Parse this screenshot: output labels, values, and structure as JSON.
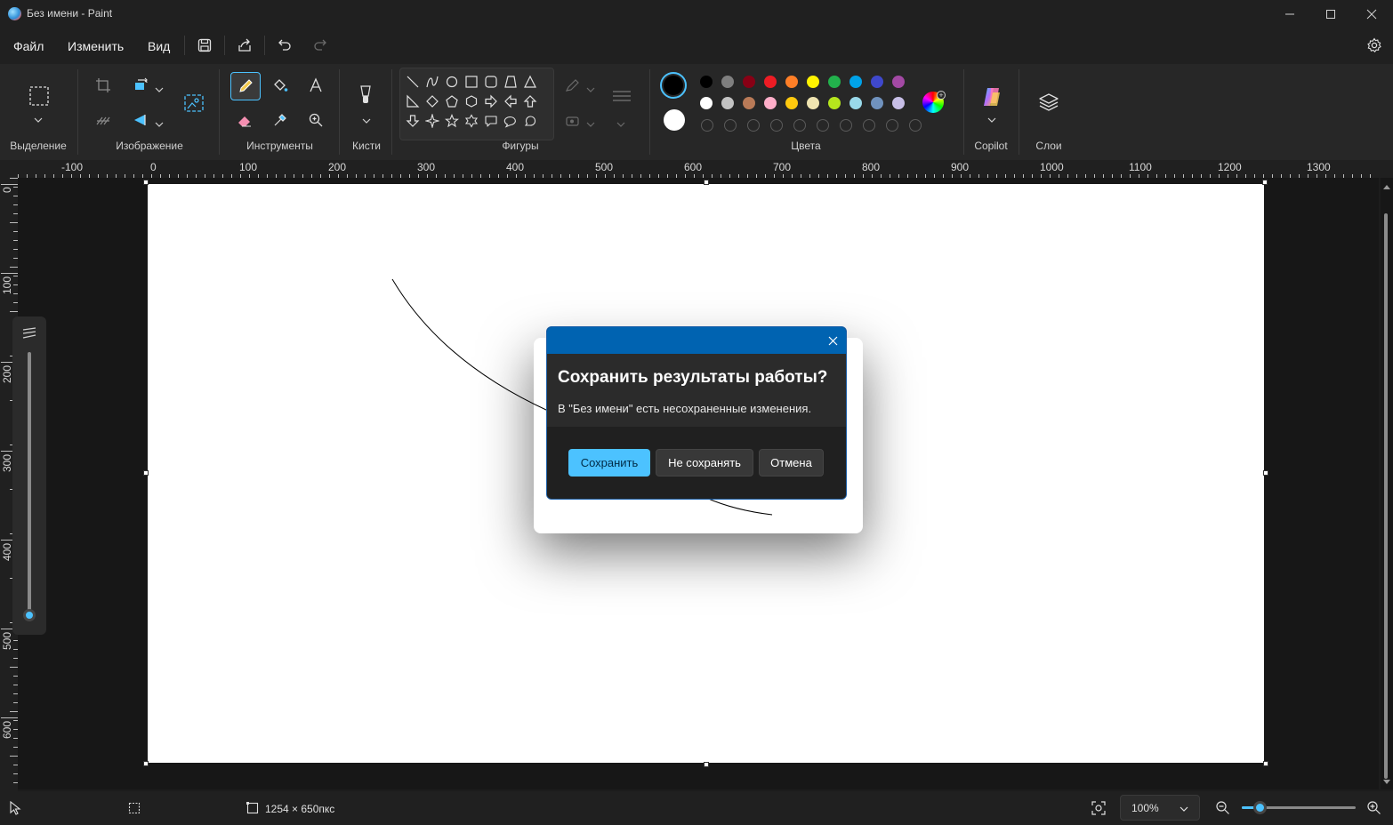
{
  "window": {
    "title": "Без имени - Paint",
    "minimize_icon": "minimize-icon",
    "maximize_icon": "maximize-icon",
    "close_icon": "close-icon"
  },
  "menu": {
    "file": "Файл",
    "edit": "Изменить",
    "view": "Вид"
  },
  "ribbon": {
    "groups": {
      "selection": "Выделение",
      "image": "Изображение",
      "tools": "Инструменты",
      "brushes": "Кисти",
      "shapes": "Фигуры",
      "colors": "Цвета",
      "copilot": "Copilot",
      "layers": "Слои"
    },
    "colors": {
      "primary": "#000000",
      "secondary": "#ffffff",
      "palette_row1": [
        "#000000",
        "#7f7f7f",
        "#880015",
        "#ed1c24",
        "#ff7f27",
        "#fff200",
        "#22b14c",
        "#00a2e8",
        "#3f48cc",
        "#a349a4"
      ],
      "palette_row2": [
        "#ffffff",
        "#c3c3c3",
        "#b97a57",
        "#ffaec9",
        "#ffc90e",
        "#efe4b0",
        "#b5e61d",
        "#99d9ea",
        "#7092be",
        "#c8bfe7"
      ]
    },
    "accent": "#4cc2ff"
  },
  "rulers": {
    "horizontal": [
      "-100",
      "0",
      "100",
      "200",
      "300",
      "400",
      "500",
      "600",
      "700",
      "800",
      "900",
      "1000",
      "1100",
      "1200",
      "1300"
    ],
    "vertical": [
      "0",
      "100",
      "200",
      "300",
      "400",
      "500",
      "600"
    ]
  },
  "status": {
    "canvas_size": "1254 × 650пкс",
    "zoom": "100%"
  },
  "dialog": {
    "heading": "Сохранить результаты работы?",
    "message": "В \"Без имени\" есть несохраненные изменения.",
    "save": "Сохранить",
    "dont_save": "Не сохранять",
    "cancel": "Отмена",
    "accent": "#0063b1",
    "save_color": "#4cc2ff"
  }
}
